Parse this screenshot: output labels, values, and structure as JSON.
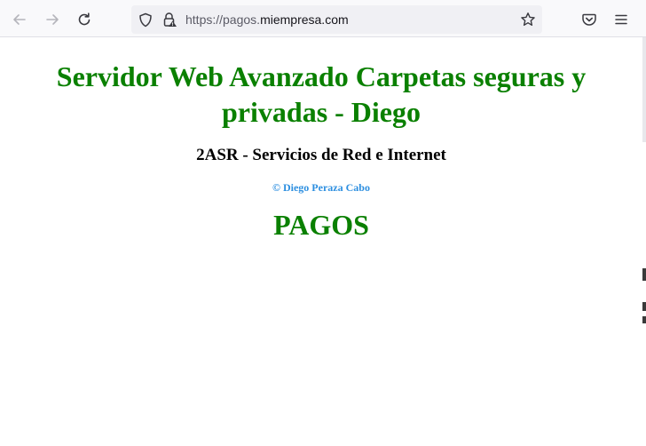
{
  "browser": {
    "url_prefix": "https://pagos.",
    "url_host": "miempresa.com",
    "icons": [
      "back-arrow-icon",
      "forward-arrow-icon",
      "reload-icon",
      "shield-icon",
      "lock-icon",
      "star-icon",
      "pocket-icon",
      "menu-icon"
    ]
  },
  "page": {
    "title": "Servidor Web Avanzado Carpetas seguras y privadas - Diego",
    "subtitle": "2ASR - Servicios de Red e Internet",
    "author": "© Diego Peraza Cabo",
    "section_title": "PAGOS"
  },
  "colors": {
    "title_green": "#0a8000",
    "author_blue": "#2d8fe0",
    "toolbar_bg": "#f9f9fb",
    "urlbar_bg": "#f0f0f4"
  }
}
